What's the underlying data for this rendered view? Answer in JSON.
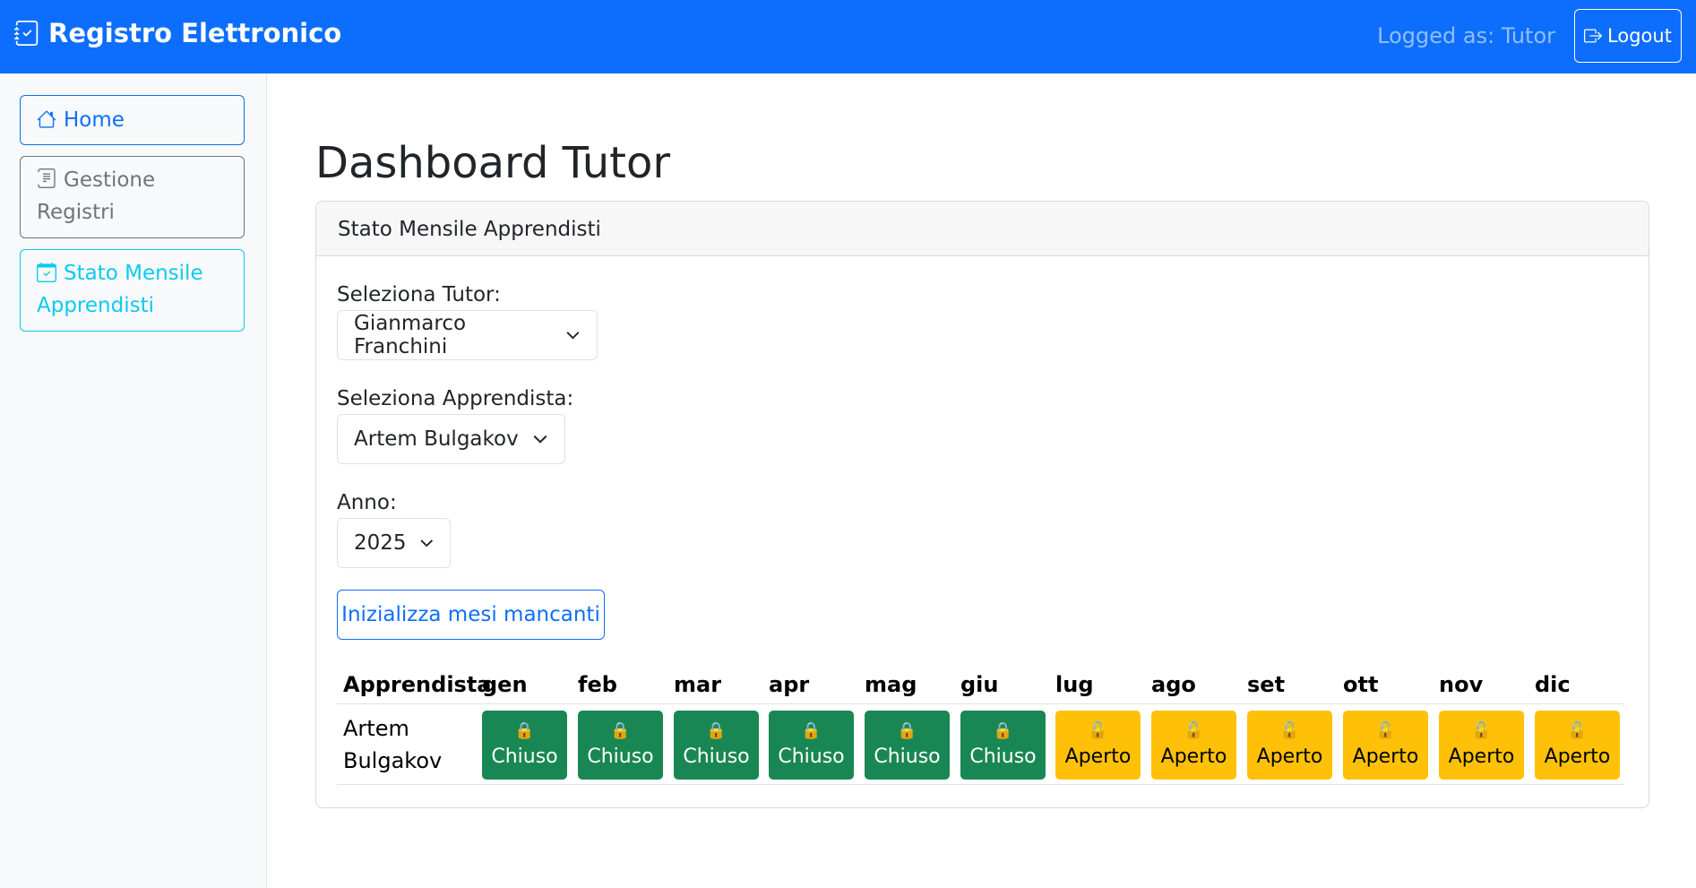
{
  "navbar": {
    "brand": "Registro Elettronico",
    "logged_as": "Logged as: Tutor",
    "logout_label": "Logout"
  },
  "sidebar": {
    "items": [
      {
        "label": "Home",
        "icon": "house-icon"
      },
      {
        "label_line1": "Gestione",
        "label_line2": "Registri",
        "icon": "journal-icon"
      },
      {
        "label_line1": "Stato Mensile",
        "label_line2": "Apprendisti",
        "icon": "calendar-check-icon"
      }
    ]
  },
  "main": {
    "title": "Dashboard Tutor",
    "card_header": "Stato Mensile Apprendisti",
    "tutor_label": "Seleziona Tutor:",
    "tutor_value": "Gianmarco Franchini",
    "apprendista_label": "Seleziona Apprendista:",
    "apprendista_value": "Artem Bulgakov",
    "anno_label": "Anno:",
    "anno_value": "2025",
    "init_button": "Inizializza mesi mancanti"
  },
  "table": {
    "header_name": "Apprendista",
    "months": [
      "gen",
      "feb",
      "mar",
      "apr",
      "mag",
      "giu",
      "lug",
      "ago",
      "set",
      "ott",
      "nov",
      "dic"
    ],
    "row": {
      "name_line1": "Artem",
      "name_line2": "Bulgakov",
      "statuses": [
        "Chiuso",
        "Chiuso",
        "Chiuso",
        "Chiuso",
        "Chiuso",
        "Chiuso",
        "Aperto",
        "Aperto",
        "Aperto",
        "Aperto",
        "Aperto",
        "Aperto"
      ]
    }
  },
  "colors": {
    "primary": "#0d6efd",
    "closed": "#198754",
    "open": "#ffc107",
    "info": "#0dcaf0"
  },
  "icons": {
    "closed_icon": "lock-icon",
    "open_icon": "unlock-icon"
  }
}
